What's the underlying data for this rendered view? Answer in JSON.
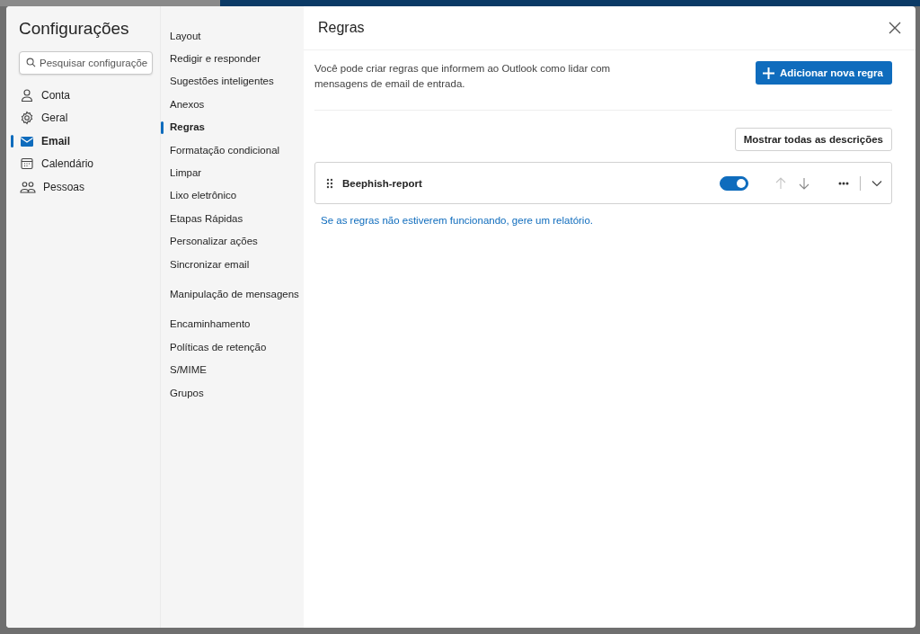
{
  "sidebar": {
    "title": "Configurações",
    "search": {
      "placeholder": "Pesquisar configuraçõe"
    },
    "items": [
      {
        "label": "Conta",
        "selected": false
      },
      {
        "label": "Geral",
        "selected": false
      },
      {
        "label": "Email",
        "selected": true
      },
      {
        "label": "Calendário",
        "selected": false
      },
      {
        "label": "Pessoas",
        "selected": false
      }
    ]
  },
  "submenu": {
    "groups": [
      {
        "items": [
          {
            "label": "Layout",
            "selected": false
          },
          {
            "label": "Redigir e responder",
            "selected": false
          },
          {
            "label": "Sugestões inteligentes",
            "selected": false
          },
          {
            "label": "Anexos",
            "selected": false
          },
          {
            "label": "Regras",
            "selected": true
          },
          {
            "label": "Formatação condicional",
            "selected": false
          },
          {
            "label": "Limpar",
            "selected": false
          },
          {
            "label": "Lixo eletrônico",
            "selected": false
          },
          {
            "label": "Etapas Rápidas",
            "selected": false
          },
          {
            "label": "Personalizar ações",
            "selected": false
          },
          {
            "label": "Sincronizar email",
            "selected": false
          }
        ]
      },
      {
        "items": [
          {
            "label": "Manipulação de mensagens",
            "selected": false
          }
        ]
      },
      {
        "items": [
          {
            "label": "Encaminhamento",
            "selected": false
          },
          {
            "label": "Políticas de retenção",
            "selected": false
          },
          {
            "label": "S/MIME",
            "selected": false
          },
          {
            "label": "Grupos",
            "selected": false
          }
        ]
      }
    ]
  },
  "panel": {
    "title": "Regras",
    "description": "Você pode criar regras que informem ao Outlook como lidar com mensagens de email de entrada.",
    "add_button": "Adicionar nova regra",
    "show_descriptions_button": "Mostrar todas as descrições",
    "rules": [
      {
        "name": "Beephish-report",
        "enabled": true
      }
    ],
    "report_link": "Se as regras não estiverem funcionando, gere um relatório."
  }
}
